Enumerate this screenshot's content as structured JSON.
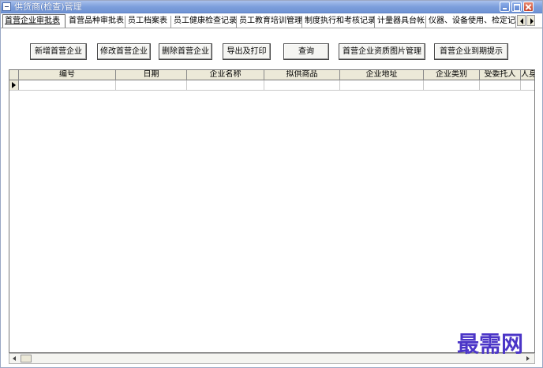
{
  "window": {
    "title": "供货商(检查)管理"
  },
  "tabs": [
    {
      "label": "首营企业审批表",
      "active": true
    },
    {
      "label": "首营品种审批表",
      "active": false
    },
    {
      "label": "员工档案表",
      "active": false
    },
    {
      "label": "员工健康检查记录",
      "active": false
    },
    {
      "label": "员工教育培训管理",
      "active": false
    },
    {
      "label": "制度执行和考核记录",
      "active": false
    },
    {
      "label": "计量器具台帐",
      "active": false
    },
    {
      "label": "仪器、设备使用、检定记录",
      "active": false
    }
  ],
  "toolbar": {
    "buttons": [
      {
        "label": "新增首营企业"
      },
      {
        "label": "修改首营企业"
      },
      {
        "label": "删除首营企业"
      },
      {
        "label": "导出及打印"
      },
      {
        "label": "查询"
      },
      {
        "label": "首营企业资质图片管理"
      },
      {
        "label": "首营企业到期提示"
      }
    ]
  },
  "grid": {
    "columns": [
      "编号",
      "日期",
      "企业名称",
      "拟供商品",
      "企业地址",
      "企业类别",
      "受委托人",
      "人身"
    ]
  },
  "watermark": "最需网",
  "icons": {
    "system": "window-menu-icon",
    "minimize": "minimize-icon",
    "maximize": "maximize-icon",
    "close": "close-icon"
  }
}
